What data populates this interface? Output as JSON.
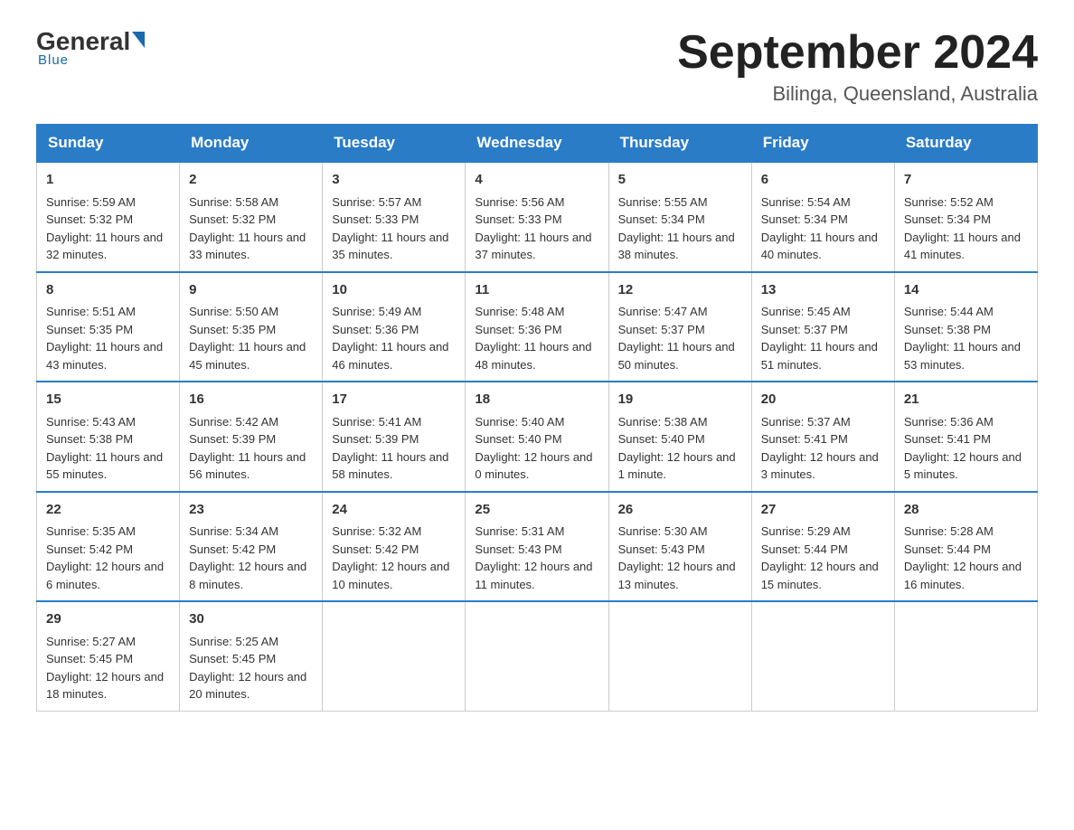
{
  "logo": {
    "general": "General",
    "blue": "Blue",
    "underline": "Blue"
  },
  "header": {
    "month": "September 2024",
    "location": "Bilinga, Queensland, Australia"
  },
  "days_of_week": [
    "Sunday",
    "Monday",
    "Tuesday",
    "Wednesday",
    "Thursday",
    "Friday",
    "Saturday"
  ],
  "weeks": [
    [
      {
        "day": "1",
        "sunrise": "5:59 AM",
        "sunset": "5:32 PM",
        "daylight": "11 hours and 32 minutes."
      },
      {
        "day": "2",
        "sunrise": "5:58 AM",
        "sunset": "5:32 PM",
        "daylight": "11 hours and 33 minutes."
      },
      {
        "day": "3",
        "sunrise": "5:57 AM",
        "sunset": "5:33 PM",
        "daylight": "11 hours and 35 minutes."
      },
      {
        "day": "4",
        "sunrise": "5:56 AM",
        "sunset": "5:33 PM",
        "daylight": "11 hours and 37 minutes."
      },
      {
        "day": "5",
        "sunrise": "5:55 AM",
        "sunset": "5:34 PM",
        "daylight": "11 hours and 38 minutes."
      },
      {
        "day": "6",
        "sunrise": "5:54 AM",
        "sunset": "5:34 PM",
        "daylight": "11 hours and 40 minutes."
      },
      {
        "day": "7",
        "sunrise": "5:52 AM",
        "sunset": "5:34 PM",
        "daylight": "11 hours and 41 minutes."
      }
    ],
    [
      {
        "day": "8",
        "sunrise": "5:51 AM",
        "sunset": "5:35 PM",
        "daylight": "11 hours and 43 minutes."
      },
      {
        "day": "9",
        "sunrise": "5:50 AM",
        "sunset": "5:35 PM",
        "daylight": "11 hours and 45 minutes."
      },
      {
        "day": "10",
        "sunrise": "5:49 AM",
        "sunset": "5:36 PM",
        "daylight": "11 hours and 46 minutes."
      },
      {
        "day": "11",
        "sunrise": "5:48 AM",
        "sunset": "5:36 PM",
        "daylight": "11 hours and 48 minutes."
      },
      {
        "day": "12",
        "sunrise": "5:47 AM",
        "sunset": "5:37 PM",
        "daylight": "11 hours and 50 minutes."
      },
      {
        "day": "13",
        "sunrise": "5:45 AM",
        "sunset": "5:37 PM",
        "daylight": "11 hours and 51 minutes."
      },
      {
        "day": "14",
        "sunrise": "5:44 AM",
        "sunset": "5:38 PM",
        "daylight": "11 hours and 53 minutes."
      }
    ],
    [
      {
        "day": "15",
        "sunrise": "5:43 AM",
        "sunset": "5:38 PM",
        "daylight": "11 hours and 55 minutes."
      },
      {
        "day": "16",
        "sunrise": "5:42 AM",
        "sunset": "5:39 PM",
        "daylight": "11 hours and 56 minutes."
      },
      {
        "day": "17",
        "sunrise": "5:41 AM",
        "sunset": "5:39 PM",
        "daylight": "11 hours and 58 minutes."
      },
      {
        "day": "18",
        "sunrise": "5:40 AM",
        "sunset": "5:40 PM",
        "daylight": "12 hours and 0 minutes."
      },
      {
        "day": "19",
        "sunrise": "5:38 AM",
        "sunset": "5:40 PM",
        "daylight": "12 hours and 1 minute."
      },
      {
        "day": "20",
        "sunrise": "5:37 AM",
        "sunset": "5:41 PM",
        "daylight": "12 hours and 3 minutes."
      },
      {
        "day": "21",
        "sunrise": "5:36 AM",
        "sunset": "5:41 PM",
        "daylight": "12 hours and 5 minutes."
      }
    ],
    [
      {
        "day": "22",
        "sunrise": "5:35 AM",
        "sunset": "5:42 PM",
        "daylight": "12 hours and 6 minutes."
      },
      {
        "day": "23",
        "sunrise": "5:34 AM",
        "sunset": "5:42 PM",
        "daylight": "12 hours and 8 minutes."
      },
      {
        "day": "24",
        "sunrise": "5:32 AM",
        "sunset": "5:42 PM",
        "daylight": "12 hours and 10 minutes."
      },
      {
        "day": "25",
        "sunrise": "5:31 AM",
        "sunset": "5:43 PM",
        "daylight": "12 hours and 11 minutes."
      },
      {
        "day": "26",
        "sunrise": "5:30 AM",
        "sunset": "5:43 PM",
        "daylight": "12 hours and 13 minutes."
      },
      {
        "day": "27",
        "sunrise": "5:29 AM",
        "sunset": "5:44 PM",
        "daylight": "12 hours and 15 minutes."
      },
      {
        "day": "28",
        "sunrise": "5:28 AM",
        "sunset": "5:44 PM",
        "daylight": "12 hours and 16 minutes."
      }
    ],
    [
      {
        "day": "29",
        "sunrise": "5:27 AM",
        "sunset": "5:45 PM",
        "daylight": "12 hours and 18 minutes."
      },
      {
        "day": "30",
        "sunrise": "5:25 AM",
        "sunset": "5:45 PM",
        "daylight": "12 hours and 20 minutes."
      },
      null,
      null,
      null,
      null,
      null
    ]
  ]
}
